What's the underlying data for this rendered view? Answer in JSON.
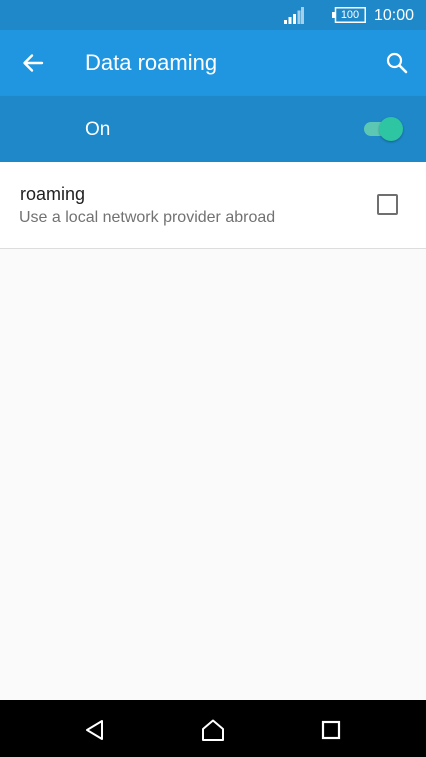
{
  "status_bar": {
    "battery_level": "100",
    "time": "10:00",
    "icons": [
      "signal-icon",
      "battery-icon"
    ]
  },
  "app_bar": {
    "title": "Data roaming",
    "back_icon": "arrow-left-icon",
    "search_icon": "search-icon"
  },
  "master_switch": {
    "label": "On",
    "checked": true,
    "accent_color": "#2dc5a2"
  },
  "settings": [
    {
      "title": "roaming",
      "summary": "Use a local network provider abroad",
      "checked": false
    }
  ],
  "nav_bar": {
    "icons": [
      "back-triangle-icon",
      "home-icon",
      "recents-square-icon"
    ]
  },
  "colors": {
    "status_bar": "#1e88c8",
    "app_bar": "#2196e0",
    "switch_bar": "#1e88c8",
    "background": "#fafafa",
    "nav_bar": "#000000"
  }
}
